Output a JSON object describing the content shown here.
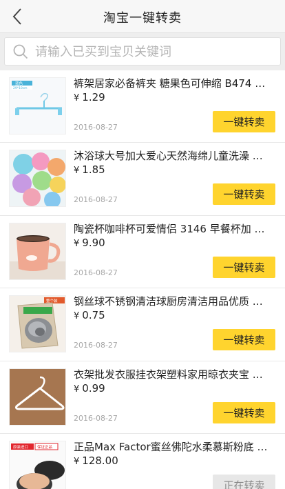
{
  "header": {
    "title": "淘宝一键转卖",
    "back_icon": "chevron-left-icon"
  },
  "search": {
    "placeholder": "请输入已买到宝贝关键词",
    "value": "",
    "icon": "search-icon"
  },
  "colors": {
    "accent": "#ffd42e",
    "price_text": "#222222",
    "date_text": "#a6a6a6"
  },
  "items": [
    {
      "name": "裤架居家必备裤夹 糖果色可伸缩 B474 …",
      "currency": "¥",
      "price": "1.29",
      "date": "2016-08-27",
      "action": "一键转卖",
      "thumb_tag": "蓝色",
      "thumb_size": "29*10cm"
    },
    {
      "name": "沐浴球大号加大爱心天然海绵儿童洗澡 …",
      "currency": "¥",
      "price": "1.85",
      "date": "2016-08-27",
      "action": "一键转卖"
    },
    {
      "name": "陶瓷杯咖啡杯可爱情侣 3146 早餐杯加 …",
      "currency": "¥",
      "price": "9.90",
      "date": "2016-08-27",
      "action": "一键转卖"
    },
    {
      "name": "钢丝球不锈钢清洁球厨房清洁用品优质 …",
      "currency": "¥",
      "price": "0.75",
      "date": "2016-08-27",
      "action": "一键转卖",
      "thumb_tag": "整个装"
    },
    {
      "name": "衣架批发衣服挂衣架塑料家用晾衣夹宝 …",
      "currency": "¥",
      "price": "0.99",
      "date": "2016-08-27",
      "action": "一键转卖"
    },
    {
      "name": "正品Max Factor蜜丝佛陀水柔慕斯粉底 …",
      "currency": "¥",
      "price": "128.00",
      "date": "",
      "action": "正在转卖",
      "thumb_tag": "原装进口",
      "thumb_tag2": "保证正品"
    }
  ]
}
